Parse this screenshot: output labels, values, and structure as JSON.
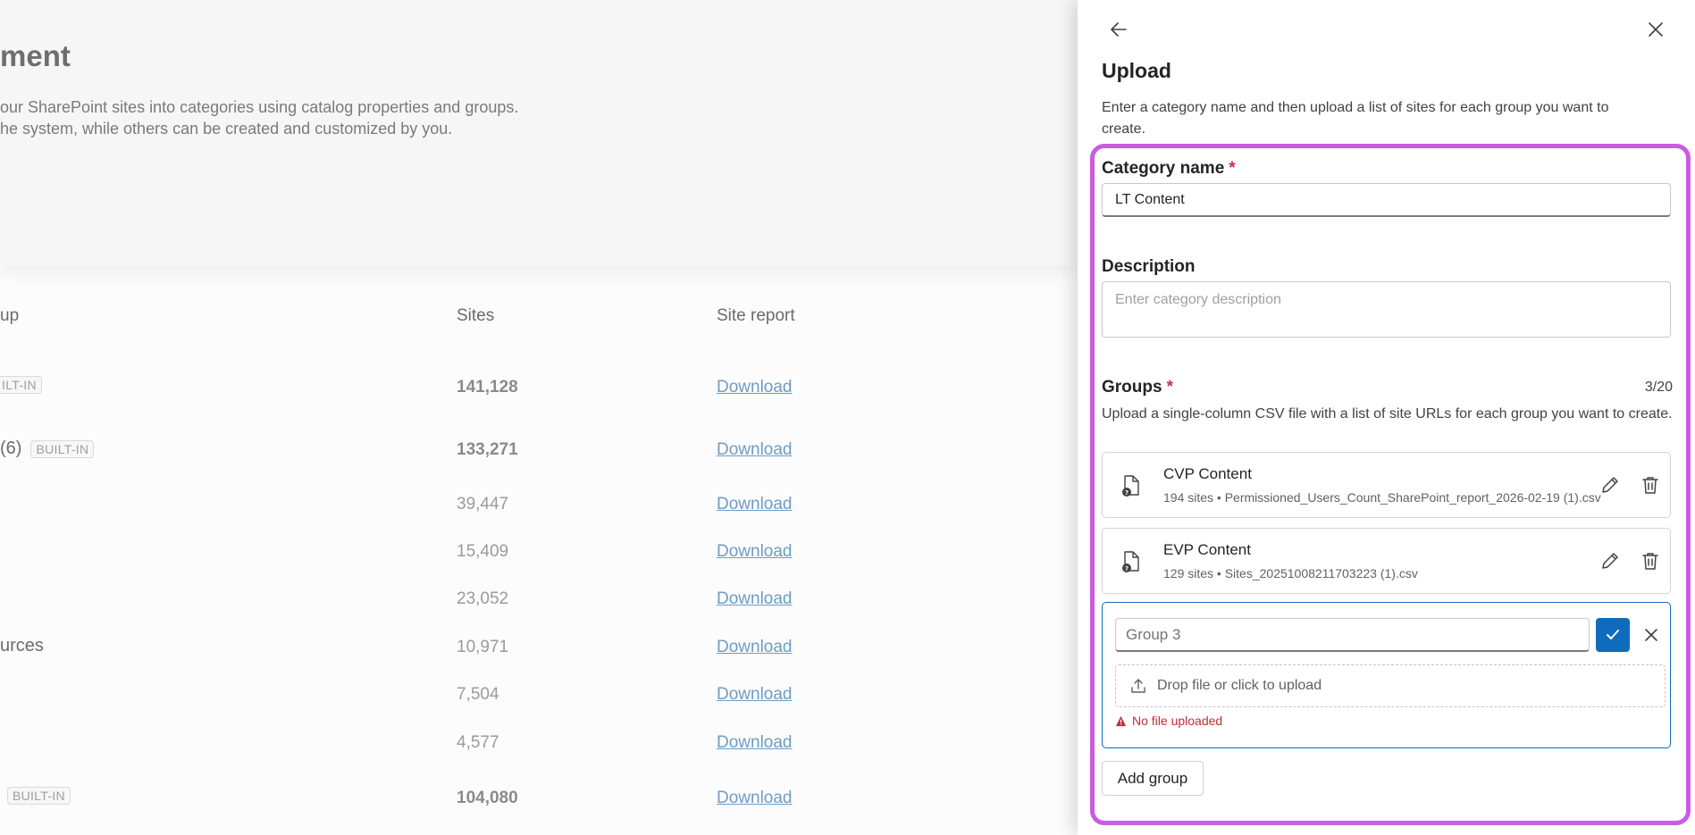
{
  "background": {
    "title_fragment": "ment",
    "description_lines": [
      "our SharePoint sites into categories using catalog properties and groups.",
      "he system, while others can be created and customized by you."
    ],
    "table": {
      "headers": {
        "group": "up",
        "sites": "Sites",
        "report": "Site report"
      },
      "rows": [
        {
          "name": "",
          "badge": "ILT-IN",
          "sites": "141,128",
          "bold": true,
          "download": "Download"
        },
        {
          "name": "(6)",
          "badge": "BUILT-IN",
          "sites": "133,271",
          "bold": true,
          "download": "Download"
        },
        {
          "name": "",
          "badge": "",
          "sites": "39,447",
          "bold": false,
          "download": "Download"
        },
        {
          "name": "",
          "badge": "",
          "sites": "15,409",
          "bold": false,
          "download": "Download"
        },
        {
          "name": "",
          "badge": "",
          "sites": "23,052",
          "bold": false,
          "download": "Download"
        },
        {
          "name": "urces",
          "badge": "",
          "sites": "10,971",
          "bold": false,
          "download": "Download"
        },
        {
          "name": "",
          "badge": "",
          "sites": "7,504",
          "bold": false,
          "download": "Download"
        },
        {
          "name": "",
          "badge": "",
          "sites": "4,577",
          "bold": false,
          "download": "Download"
        },
        {
          "name": "",
          "badge": "BUILT-IN",
          "sites": "104,080",
          "bold": true,
          "download": "Download"
        }
      ]
    }
  },
  "panel": {
    "back_icon": "arrow-left-icon",
    "close_icon": "close-icon",
    "title": "Upload",
    "description": "Enter a category name and then upload a list of sites for each group you want to create.",
    "category_name": {
      "label": "Category name",
      "required_mark": "*",
      "value": "LT Content"
    },
    "description_field": {
      "label": "Description",
      "placeholder": "Enter category description"
    },
    "groups": {
      "label": "Groups",
      "required_mark": "*",
      "counter": "3/20",
      "help": "Upload a single-column CSV file with a list of site URLs for each group you want to create.",
      "items": [
        {
          "name": "CVP Content",
          "meta": "194 sites • Permissioned_Users_Count_SharePoint_report_2026-02-19 (1).csv"
        },
        {
          "name": "EVP Content",
          "meta": "129 sites • Sites_20251008211703223 (1).csv"
        }
      ],
      "new_group": {
        "placeholder": "Group 3",
        "dropzone_label": "Drop file or click to upload",
        "error": "No file uploaded"
      },
      "add_group_label": "Add group"
    },
    "highlight_color": "#c95ce0",
    "accent_color": "#0f6cbd",
    "error_color": "#bc2f32"
  }
}
